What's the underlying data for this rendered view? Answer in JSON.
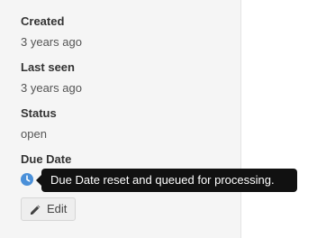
{
  "sidebar": {
    "fields": [
      {
        "label": "Created",
        "value": "3 years ago"
      },
      {
        "label": "Last seen",
        "value": "3 years ago"
      },
      {
        "label": "Status",
        "value": "open"
      }
    ],
    "due_date": {
      "label": "Due Date",
      "icon": "clock-icon",
      "tooltip": "Due Date reset and queued for processing."
    },
    "edit_button": {
      "icon": "pencil-icon",
      "label": "Edit"
    }
  },
  "colors": {
    "panel_bg": "#f5f5f5",
    "accent_blue": "#4a90d9",
    "tooltip_bg": "#111111"
  }
}
